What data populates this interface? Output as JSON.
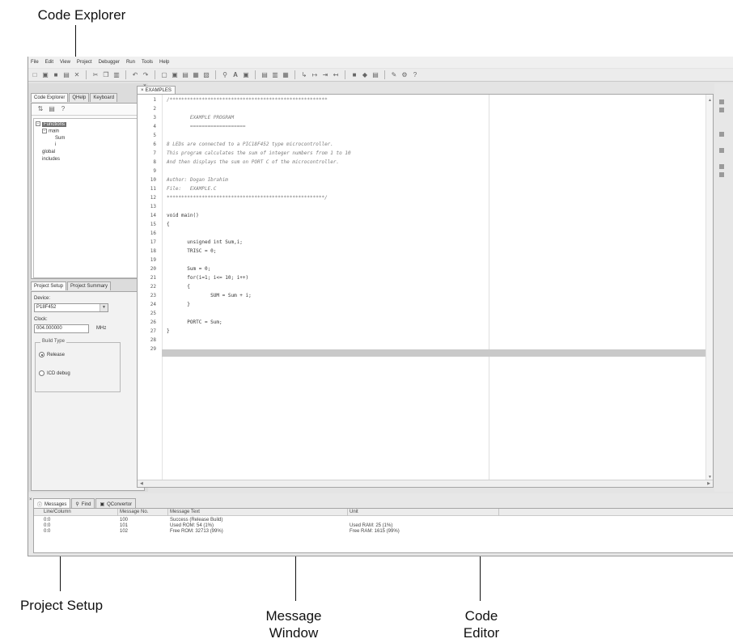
{
  "callouts": {
    "code_explorer": "Code Explorer",
    "project_setup": "Project Setup",
    "message_window": [
      "Message",
      "Window"
    ],
    "code_editor": [
      "Code",
      "Editor"
    ]
  },
  "menu": [
    "File",
    "Edit",
    "View",
    "Project",
    "Debugger",
    "Run",
    "Tools",
    "Help"
  ],
  "left_panel": {
    "tabs": [
      "Code Explorer",
      "QHelp",
      "Keyboard"
    ],
    "tree": {
      "functions_label": "Functions",
      "main_label": "main",
      "sum_label": "Sum",
      "i_label": "i",
      "global_label": "global",
      "includes_label": "includes"
    },
    "setup_tabs": [
      "Project Setup",
      "Project Summary"
    ],
    "device_label": "Device:",
    "device_value": "P18F452",
    "clock_label": "Clock:",
    "clock_value": "004.000000",
    "clock_unit": "MHz",
    "build_type_label": "Build Type",
    "release_label": "Release",
    "icd_label": "ICD debug"
  },
  "editor": {
    "tab_label": "EXAMPLES",
    "lines": [
      {
        "n": "1",
        "t": "/******************************************************"
      },
      {
        "n": "2",
        "t": ""
      },
      {
        "n": "3",
        "t": "        EXAMPLE PROGRAM"
      },
      {
        "n": "4",
        "t": "        ==================="
      },
      {
        "n": "5",
        "t": ""
      },
      {
        "n": "6",
        "t": "8 LEDs are connected to a PIC18F452 type microcontroller."
      },
      {
        "n": "7",
        "t": "This program calculates the sum of integer numbers from 1 to 10"
      },
      {
        "n": "8",
        "t": "And then displays the sum on PORT C of the microcontroller."
      },
      {
        "n": "9",
        "t": ""
      },
      {
        "n": "10",
        "t": "Author: Dogan Ibrahim"
      },
      {
        "n": "11",
        "t": "File:   EXAMPLE.C"
      },
      {
        "n": "12",
        "t": "******************************************************/"
      },
      {
        "n": "13",
        "t": ""
      },
      {
        "n": "14",
        "t": "void main()"
      },
      {
        "n": "15",
        "t": "{"
      },
      {
        "n": "16",
        "t": ""
      },
      {
        "n": "17",
        "t": "       unsigned int Sum,i;"
      },
      {
        "n": "18",
        "t": "       TRISC = 0;"
      },
      {
        "n": "19",
        "t": ""
      },
      {
        "n": "20",
        "t": "       Sum = 0;"
      },
      {
        "n": "21",
        "t": "       for(i=1; i<= 10; i++)"
      },
      {
        "n": "22",
        "t": "       {"
      },
      {
        "n": "23",
        "t": "               SUM = Sum + i;"
      },
      {
        "n": "24",
        "t": "       }"
      },
      {
        "n": "25",
        "t": ""
      },
      {
        "n": "26",
        "t": "       PORTC = Sum;"
      },
      {
        "n": "27",
        "t": "}"
      },
      {
        "n": "28",
        "t": ""
      },
      {
        "n": "29",
        "t": ""
      }
    ]
  },
  "messages": {
    "tabs": [
      "Messages",
      "Find",
      "QConvertor"
    ],
    "columns": [
      "Line/Column",
      "Message No.",
      "Message Text",
      "Unit"
    ],
    "rows": [
      [
        "0:0",
        "100",
        "Success (Release Build)",
        ""
      ],
      [
        "0:0",
        "101",
        "Used ROM: 54  (1%)",
        "Used RAM: 25  (1%)"
      ],
      [
        "0:0",
        "102",
        "Free ROM: 32713  (99%)",
        "Free RAM: 1615  (99%)"
      ]
    ]
  }
}
